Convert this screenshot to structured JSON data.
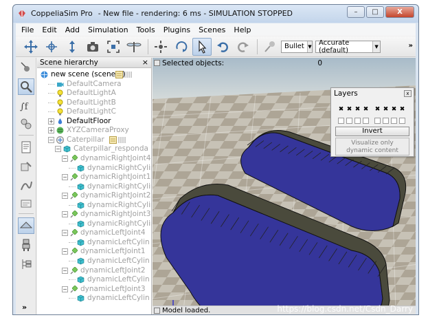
{
  "window": {
    "app_name": "CoppeliaSim Pro",
    "title_status": "- New file - rendering: 6 ms - SIMULATION STOPPED",
    "minimize": "–",
    "maximize": "□",
    "close": "X"
  },
  "menu": [
    "File",
    "Edit",
    "Add",
    "Simulation",
    "Tools",
    "Plugins",
    "Scenes",
    "Help"
  ],
  "toolbar": {
    "engine": "Bullet",
    "accuracy": "Accurate (default)",
    "more": "»"
  },
  "hierarchy": {
    "title": "Scene hierarchy",
    "close": "×",
    "items": [
      {
        "label": "new scene (scene 1)"
      },
      {
        "label": "DefaultCamera"
      },
      {
        "label": "DefaultLightA"
      },
      {
        "label": "DefaultLightB"
      },
      {
        "label": "DefaultLightC"
      },
      {
        "label": "DefaultFloor"
      },
      {
        "label": "XYZCameraProxy"
      },
      {
        "label": "Caterpillar"
      },
      {
        "label": "Caterpillar_responda"
      },
      {
        "label": "dynamicRightJoint4"
      },
      {
        "label": "dynamicRightCylin"
      },
      {
        "label": "dynamicRightJoint1"
      },
      {
        "label": "dynamicRightCylin"
      },
      {
        "label": "dynamicRightJoint2"
      },
      {
        "label": "dynamicRightCylin"
      },
      {
        "label": "dynamicRightJoint3"
      },
      {
        "label": "dynamicRightCylin"
      },
      {
        "label": "dynamicLeftJoint4"
      },
      {
        "label": "dynamicLeftCylin"
      },
      {
        "label": "dynamicLeftJoint1"
      },
      {
        "label": "dynamicLeftCylin"
      },
      {
        "label": "dynamicLeftJoint2"
      },
      {
        "label": "dynamicLeftCylin"
      },
      {
        "label": "dynamicLeftJoint3"
      },
      {
        "label": "dynamicLeftCylin"
      }
    ],
    "collapse": "»"
  },
  "viewport": {
    "selected_label": "Selected objects:",
    "selected_count": "0",
    "status": "Model loaded.",
    "watermark": "https://blog.csdn.net/Csdn_Darry"
  },
  "layers": {
    "title": "Layers",
    "close": "x",
    "layers_on": [
      true,
      true,
      true,
      true,
      true,
      true,
      true,
      true
    ],
    "layers_second_row": [
      false,
      false,
      false,
      false,
      false,
      false,
      false,
      false
    ],
    "check_mark": "✖",
    "invert": "Invert",
    "visualize_line1": "Visualize only",
    "visualize_line2": "dynamic content"
  },
  "colors": {
    "track_body": "#35359a",
    "track_tread": "#4a4a3c",
    "floor_light": "#c7c2b6",
    "floor_dark": "#ada596",
    "sky_top": "#a8bbc9",
    "sky_bottom": "#e2e4df"
  }
}
